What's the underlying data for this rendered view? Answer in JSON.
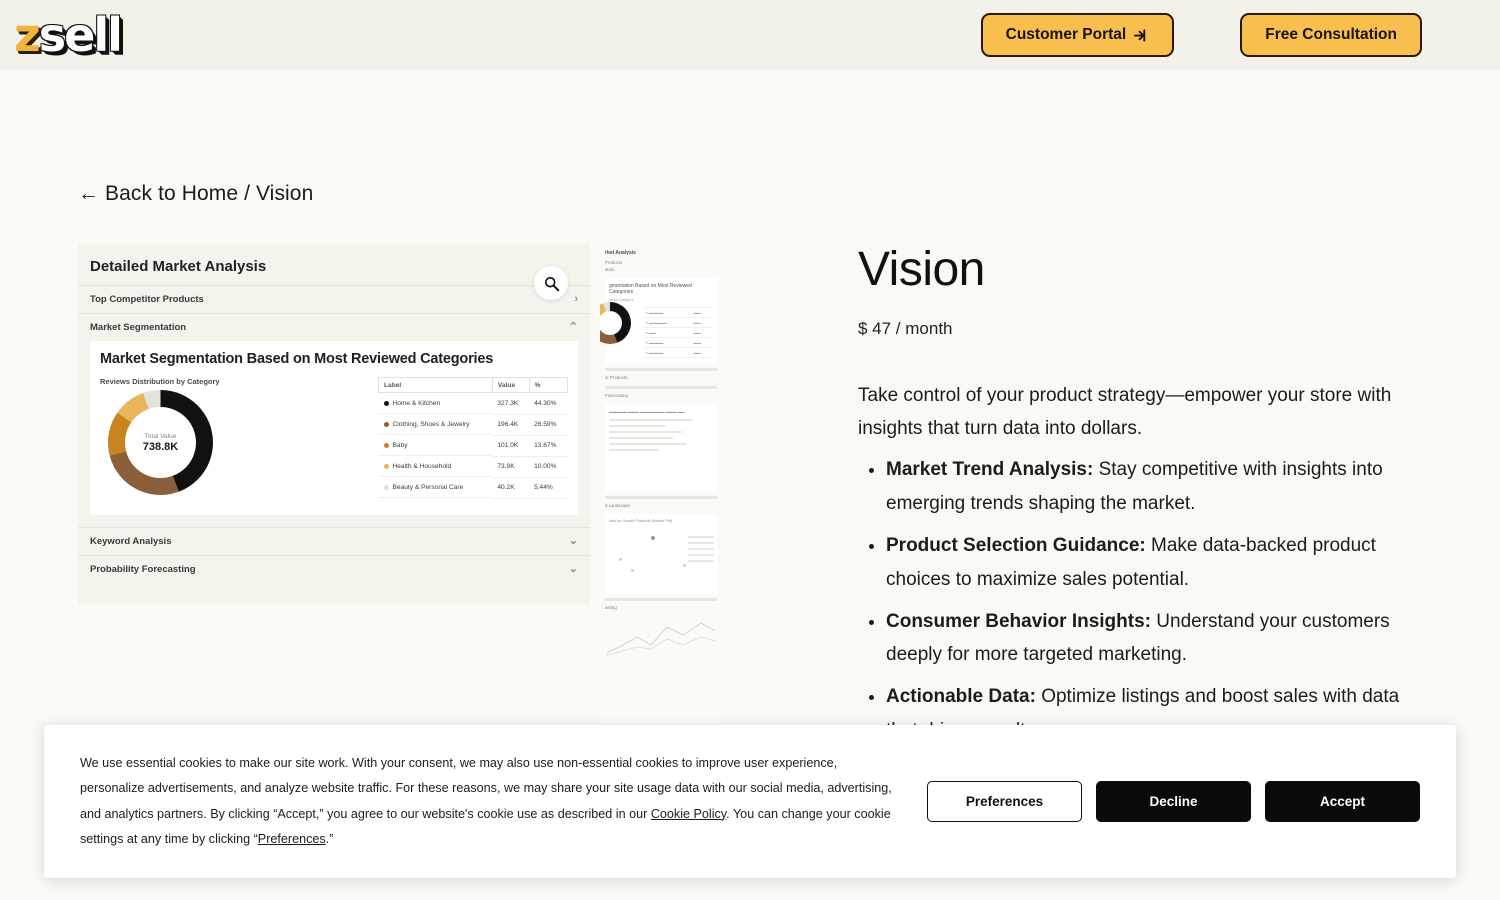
{
  "header": {
    "logo_z": "z",
    "logo_rest": "sell",
    "customer_portal_label": "Customer Portal",
    "customer_portal_icon": "sign-in-icon",
    "free_consultation_label": "Free Consultation"
  },
  "breadcrumb": {
    "back_arrow": "←",
    "back_label": "Back to Home",
    "separator": "/",
    "current": "Vision"
  },
  "gallery": {
    "zoom_icon": "magnifier-icon",
    "screenshot": {
      "title": "Detailed Market Analysis",
      "accordions": [
        {
          "label": "Top Competitor Products",
          "state": "collapsed",
          "chevron": "›"
        },
        {
          "label": "Market Segmentation",
          "state": "expanded",
          "chevron": "⌃"
        },
        {
          "label": "Keyword Analysis",
          "state": "collapsed",
          "chevron": "⌄"
        },
        {
          "label": "Probability Forecasting",
          "state": "collapsed",
          "chevron": "⌄"
        }
      ],
      "panel_title": "Market Segmentation Based on Most Reviewed Categories",
      "chart_caption": "Reviews Distribution by Category",
      "donut_center_label": "Total Value",
      "donut_center_value": "738.8K",
      "table_headers": [
        "Label",
        "Value",
        "%"
      ],
      "rows": [
        {
          "label": "Home & Kitchen",
          "value": "327.3K",
          "pct": "44.30%",
          "color": "#111111"
        },
        {
          "label": "Clothing, Shoes & Jewelry",
          "value": "196.4K",
          "pct": "26.59%",
          "color": "#8b5e3c"
        },
        {
          "label": "Baby",
          "value": "101.0K",
          "pct": "13.67%",
          "color": "#c8841f"
        },
        {
          "label": "Health & Household",
          "value": "73.9K",
          "pct": "10.00%",
          "color": "#e8b45c"
        },
        {
          "label": "Beauty & Personal Care",
          "value": "40.2K",
          "pct": "5.44%",
          "color": "#e3e2dc"
        }
      ]
    },
    "next_preview": {
      "head": "rket Analysis",
      "sub1": "Products",
      "sub2": "ation",
      "panel_title": "gmentation Based on Most Reviewed Categories",
      "caption": "on by Category",
      "sec_a": "or Products",
      "sec_b": "Forecasting",
      "sec_c": "d Landscape",
      "sec_d": "asting",
      "scatter_title": "kets by Growth Potential (Bubble Pfd)"
    }
  },
  "chart_data": {
    "type": "pie",
    "title": "Market Segmentation Based on Most Reviewed Categories",
    "subtitle": "Reviews Distribution by Category",
    "center_label": "Total Value",
    "center_value": "738.8K",
    "total": 738800,
    "categories": [
      "Home & Kitchen",
      "Clothing, Shoes & Jewelry",
      "Baby",
      "Health & Household",
      "Beauty & Personal Care"
    ],
    "values": [
      327300,
      196400,
      101000,
      73900,
      40200
    ],
    "value_labels": [
      "327.3K",
      "196.4K",
      "101.0K",
      "73.9K",
      "40.2K"
    ],
    "percentages": [
      44.3,
      26.59,
      13.67,
      10.0,
      5.44
    ],
    "percentage_labels": [
      "44.30%",
      "26.59%",
      "13.67%",
      "10.00%",
      "5.44%"
    ],
    "colors": [
      "#111111",
      "#8b5e3c",
      "#c8841f",
      "#e8b45c",
      "#e3e2dc"
    ],
    "legend": "table-right",
    "grid": false
  },
  "product": {
    "title": "Vision",
    "price": "$ 47 / month",
    "description": "Take control of your product strategy—empower your store with insights that turn data into dollars.",
    "features": [
      {
        "bold": "Market Trend Analysis:",
        "text": " Stay competitive with insights into emerging trends shaping the market."
      },
      {
        "bold": "Product Selection Guidance:",
        "text": " Make data-backed product choices to maximize sales potential."
      },
      {
        "bold": "Consumer Behavior Insights:",
        "text": " Understand your customers deeply for more targeted marketing."
      },
      {
        "bold": "Actionable Data:",
        "text": " Optimize listings and boost sales with data that drives results."
      }
    ],
    "cta_label": ""
  },
  "cookie_banner": {
    "part1": "We use essential cookies to make our site work. With your consent, we may also use non-essential cookies to improve user experience, personalize advertisements, and analyze website traffic. For these reasons, we may share your site usage data with our social media, advertising, and analytics partners. By clicking “Accept,” you agree to our website's cookie use as described in our ",
    "cookie_policy_link": "Cookie Policy",
    "part2": ". You can change your cookie settings at any time by clicking “",
    "preferences_link": "Preferences",
    "part3": ".”",
    "preferences_label": "Preferences",
    "decline_label": "Decline",
    "accept_label": "Accept"
  },
  "colors": {
    "brand_yellow": "#f8bf4f",
    "page_bg": "#faf9f4",
    "header_bg": "#f2f1ea",
    "dark": "#0a0a0a"
  }
}
